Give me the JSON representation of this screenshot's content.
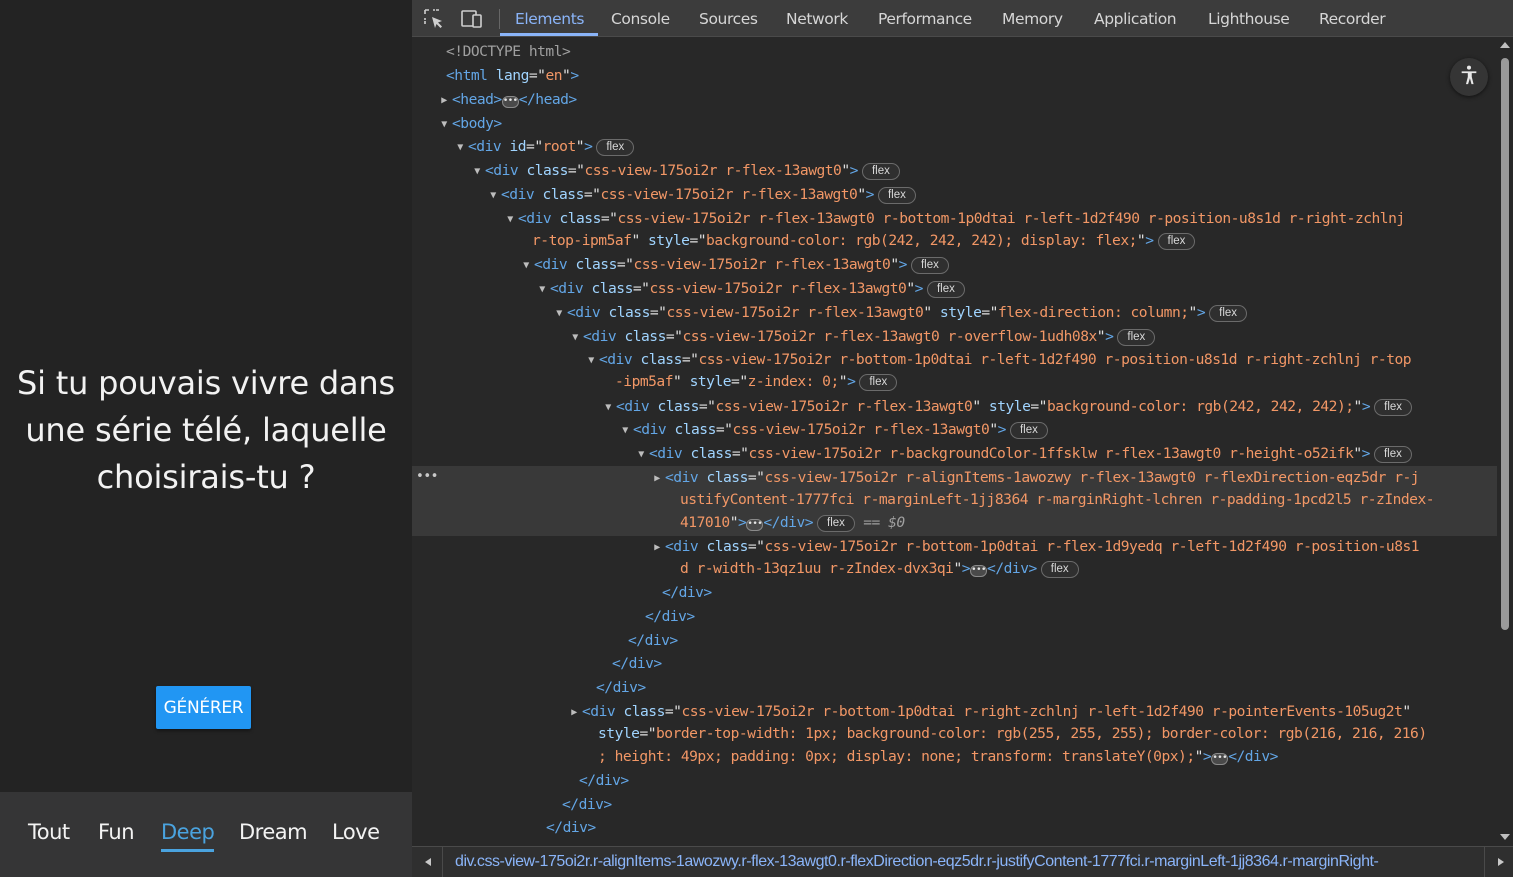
{
  "app": {
    "question": "Si tu pouvais vivre dans une série télé, laquelle choisirais-tu ?",
    "generate_button": "GÉNÉRER",
    "categories": [
      "Tout",
      "Fun",
      "Deep",
      "Dream",
      "Love"
    ],
    "active_category": "Deep"
  },
  "devtools": {
    "tabs": [
      "Elements",
      "Console",
      "Sources",
      "Network",
      "Performance",
      "Memory",
      "Application",
      "Lighthouse",
      "Recorder"
    ],
    "active_tab": "Elements",
    "icons": [
      "inspect-element-icon",
      "device-toolbar-icon",
      "accessibility-icon"
    ],
    "selected_suffix": "== $0",
    "breadcrumb": "div.css-view-175oi2r.r-alignItems-1awozwy.r-flex-13awgt0.r-flexDirection-eqz5dr.r-justifyContent-1777fci.r-marginLeft-1jj8364.r-marginRight-",
    "colors": {
      "accent": "#8ab4f8",
      "tag": "#63a6e6",
      "attr_name": "#a0d4ff",
      "attr_value": "#f29766",
      "app_active": "#4aa3df",
      "button": "#2196f3"
    }
  },
  "dom": [
    [
      [
        "cm",
        "<!DOCTYPE html>"
      ]
    ],
    [
      [
        "t",
        "<html"
      ],
      [
        "pl",
        " "
      ],
      [
        "an",
        "lang"
      ],
      [
        "pl",
        "=\""
      ],
      [
        "av",
        "en"
      ],
      [
        "pl",
        "\""
      ],
      [
        "t",
        ">"
      ]
    ],
    [
      [
        "t",
        "<head>"
      ],
      [
        "ellipsis",
        ""
      ],
      [
        "t",
        "</head>"
      ]
    ],
    [
      [
        "t",
        "<body>"
      ]
    ],
    [
      [
        "t",
        "<div"
      ],
      [
        "pl",
        " "
      ],
      [
        "an",
        "id"
      ],
      [
        "pl",
        "=\""
      ],
      [
        "av",
        "root"
      ],
      [
        "pl",
        "\""
      ],
      [
        "t",
        ">"
      ],
      [
        "badge",
        "flex"
      ]
    ],
    [
      [
        "t",
        "<div"
      ],
      [
        "pl",
        " "
      ],
      [
        "an",
        "class"
      ],
      [
        "pl",
        "=\""
      ],
      [
        "av",
        "css-view-175oi2r r-flex-13awgt0"
      ],
      [
        "pl",
        "\""
      ],
      [
        "t",
        ">"
      ],
      [
        "badge",
        "flex"
      ]
    ],
    [
      [
        "t",
        "<div"
      ],
      [
        "pl",
        " "
      ],
      [
        "an",
        "class"
      ],
      [
        "pl",
        "=\""
      ],
      [
        "av",
        "css-view-175oi2r r-flex-13awgt0"
      ],
      [
        "pl",
        "\""
      ],
      [
        "t",
        ">"
      ],
      [
        "badge",
        "flex"
      ]
    ],
    [
      [
        "t",
        "<div"
      ],
      [
        "pl",
        " "
      ],
      [
        "an",
        "class"
      ],
      [
        "pl",
        "=\""
      ],
      [
        "av",
        "css-view-175oi2r r-flex-13awgt0 r-bottom-1p0dtai r-left-1d2f490 r-position-u8s1d r-right-zchlnj"
      ]
    ],
    [
      [
        "av",
        "r-top-ipm5af"
      ],
      [
        "pl",
        "\" "
      ],
      [
        "an",
        "style"
      ],
      [
        "pl",
        "=\""
      ],
      [
        "av",
        "background-color: rgb(242, 242, 242); display: flex;"
      ],
      [
        "pl",
        "\""
      ],
      [
        "t",
        ">"
      ],
      [
        "badge",
        "flex"
      ]
    ],
    [
      [
        "t",
        "<div"
      ],
      [
        "pl",
        " "
      ],
      [
        "an",
        "class"
      ],
      [
        "pl",
        "=\""
      ],
      [
        "av",
        "css-view-175oi2r r-flex-13awgt0"
      ],
      [
        "pl",
        "\""
      ],
      [
        "t",
        ">"
      ],
      [
        "badge",
        "flex"
      ]
    ],
    [
      [
        "t",
        "<div"
      ],
      [
        "pl",
        " "
      ],
      [
        "an",
        "class"
      ],
      [
        "pl",
        "=\""
      ],
      [
        "av",
        "css-view-175oi2r r-flex-13awgt0"
      ],
      [
        "pl",
        "\""
      ],
      [
        "t",
        ">"
      ],
      [
        "badge",
        "flex"
      ]
    ],
    [
      [
        "t",
        "<div"
      ],
      [
        "pl",
        " "
      ],
      [
        "an",
        "class"
      ],
      [
        "pl",
        "=\""
      ],
      [
        "av",
        "css-view-175oi2r r-flex-13awgt0"
      ],
      [
        "pl",
        "\" "
      ],
      [
        "an",
        "style"
      ],
      [
        "pl",
        "=\""
      ],
      [
        "av",
        "flex-direction: column;"
      ],
      [
        "pl",
        "\""
      ],
      [
        "t",
        ">"
      ],
      [
        "badge",
        "flex"
      ]
    ],
    [
      [
        "t",
        "<div"
      ],
      [
        "pl",
        " "
      ],
      [
        "an",
        "class"
      ],
      [
        "pl",
        "=\""
      ],
      [
        "av",
        "css-view-175oi2r r-flex-13awgt0 r-overflow-1udh08x"
      ],
      [
        "pl",
        "\""
      ],
      [
        "t",
        ">"
      ],
      [
        "badge",
        "flex"
      ]
    ],
    [
      [
        "t",
        "<div"
      ],
      [
        "pl",
        " "
      ],
      [
        "an",
        "class"
      ],
      [
        "pl",
        "=\""
      ],
      [
        "av",
        "css-view-175oi2r r-bottom-1p0dtai r-left-1d2f490 r-position-u8s1d r-right-zchlnj r-top"
      ]
    ],
    [
      [
        "av",
        "-ipm5af"
      ],
      [
        "pl",
        "\" "
      ],
      [
        "an",
        "style"
      ],
      [
        "pl",
        "=\""
      ],
      [
        "av",
        "z-index: 0;"
      ],
      [
        "pl",
        "\""
      ],
      [
        "t",
        ">"
      ],
      [
        "badge",
        "flex"
      ]
    ],
    [
      [
        "t",
        "<div"
      ],
      [
        "pl",
        " "
      ],
      [
        "an",
        "class"
      ],
      [
        "pl",
        "=\""
      ],
      [
        "av",
        "css-view-175oi2r r-flex-13awgt0"
      ],
      [
        "pl",
        "\" "
      ],
      [
        "an",
        "style"
      ],
      [
        "pl",
        "=\""
      ],
      [
        "av",
        "background-color: rgb(242, 242, 242);"
      ],
      [
        "pl",
        "\""
      ],
      [
        "t",
        ">"
      ],
      [
        "badge",
        "flex"
      ]
    ],
    [
      [
        "t",
        "<div"
      ],
      [
        "pl",
        " "
      ],
      [
        "an",
        "class"
      ],
      [
        "pl",
        "=\""
      ],
      [
        "av",
        "css-view-175oi2r r-flex-13awgt0"
      ],
      [
        "pl",
        "\""
      ],
      [
        "t",
        ">"
      ],
      [
        "badge",
        "flex"
      ]
    ],
    [
      [
        "t",
        "<div"
      ],
      [
        "pl",
        " "
      ],
      [
        "an",
        "class"
      ],
      [
        "pl",
        "=\""
      ],
      [
        "av",
        "css-view-175oi2r r-backgroundColor-1ffsklw r-flex-13awgt0 r-height-o52ifk"
      ],
      [
        "pl",
        "\""
      ],
      [
        "t",
        ">"
      ],
      [
        "badge",
        "flex"
      ]
    ],
    [
      [
        "t",
        "<div"
      ],
      [
        "pl",
        " "
      ],
      [
        "an",
        "class"
      ],
      [
        "pl",
        "=\""
      ],
      [
        "av",
        "css-view-175oi2r r-alignItems-1awozwy r-flex-13awgt0 r-flexDirection-eqz5dr r-j"
      ]
    ],
    [
      [
        "av",
        "ustifyContent-1777fci r-marginLeft-1jj8364 r-marginRight-lchren r-padding-1pcd2l5 r-zIndex-"
      ]
    ],
    [
      [
        "av",
        "417010"
      ],
      [
        "pl",
        "\""
      ],
      [
        "t",
        ">"
      ],
      [
        "ellipsis",
        ""
      ],
      [
        "t",
        "</div>"
      ],
      [
        "badge",
        "flex"
      ],
      [
        "cm",
        "  == "
      ],
      [
        "cm",
        "$0"
      ]
    ],
    [
      [
        "t",
        "<div"
      ],
      [
        "pl",
        " "
      ],
      [
        "an",
        "class"
      ],
      [
        "pl",
        "=\""
      ],
      [
        "av",
        "css-view-175oi2r r-bottom-1p0dtai r-flex-1d9yedq r-left-1d2f490 r-position-u8s1"
      ]
    ],
    [
      [
        "av",
        "d r-width-13qz1uu r-zIndex-dvx3qi"
      ],
      [
        "pl",
        "\""
      ],
      [
        "t",
        ">"
      ],
      [
        "ellipsis",
        ""
      ],
      [
        "t",
        "</div>"
      ],
      [
        "badge",
        "flex"
      ]
    ],
    [
      [
        "t",
        "</div>"
      ]
    ],
    [
      [
        "t",
        "</div>"
      ]
    ],
    [
      [
        "t",
        "</div>"
      ]
    ],
    [
      [
        "t",
        "</div>"
      ]
    ],
    [
      [
        "t",
        "</div>"
      ]
    ],
    [
      [
        "t",
        "<div"
      ],
      [
        "pl",
        " "
      ],
      [
        "an",
        "class"
      ],
      [
        "pl",
        "=\""
      ],
      [
        "av",
        "css-view-175oi2r r-bottom-1p0dtai r-right-zchlnj r-left-1d2f490 r-pointerEvents-105ug2t"
      ],
      [
        "pl",
        "\""
      ]
    ],
    [
      [
        "an",
        "style"
      ],
      [
        "pl",
        "=\""
      ],
      [
        "av",
        "border-top-width: 1px; background-color: rgb(255, 255, 255); border-color: rgb(216, 216, 216)"
      ]
    ],
    [
      [
        "av",
        "; height: 49px; padding: 0px; display: none; transform: translateY(0px);"
      ],
      [
        "pl",
        "\""
      ],
      [
        "t",
        ">"
      ],
      [
        "ellipsis",
        ""
      ],
      [
        "t",
        "</div>"
      ]
    ],
    [
      [
        "t",
        "</div>"
      ]
    ],
    [
      [
        "t",
        "</div>"
      ]
    ],
    [
      [
        "t",
        "</div>"
      ]
    ]
  ]
}
